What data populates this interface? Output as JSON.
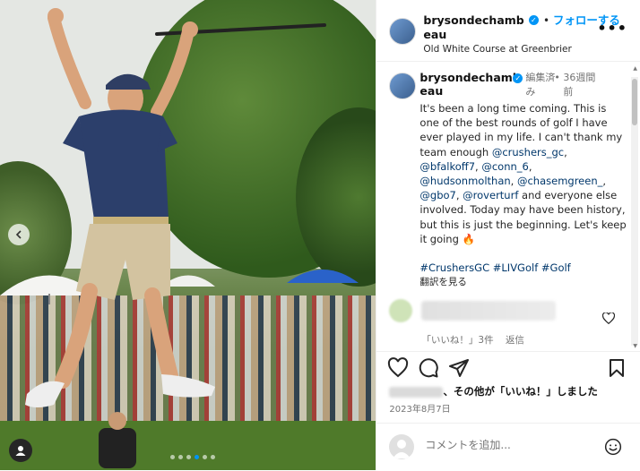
{
  "post": {
    "username": "brysondechambeau",
    "username_line1": "brysondechamb",
    "username_line2": "eau",
    "follow_label": "フォローする",
    "location": "Old White Course at Greenbrier",
    "more_label": "•••"
  },
  "caption": {
    "username_line1": "brysondechamb",
    "username_line2": "eau",
    "edited_line1": "編集済",
    "edited_line2": "み",
    "age_line1": "36週間",
    "age_line2": "前",
    "text_part1": "It's been a long time coming. This is one of the best rounds of golf I have ever played in my life. I can't thank my team enough ",
    "mention1": "@crushers_gc",
    "comma1": ", ",
    "mention2": "@bfalkoff7",
    "comma2": ", ",
    "mention3": "@conn_6",
    "comma3": ", ",
    "mention4": "@hudsonmolthan",
    "comma4": ", ",
    "mention5": "@chasemgreen_",
    "comma5": ", ",
    "mention6": "@gbo7",
    "comma6": ", ",
    "mention7": "@roverturf",
    "text_part2": " and everyone else involved. Today may have been history, but this is just the beginning. Let's keep it going 🔥",
    "hashtags": "#CrushersGC #LIVGolf #Golf",
    "translate_label": "翻訳を見る"
  },
  "comment": {
    "likes_label": "「いいね！」3件",
    "reply_label": "返信"
  },
  "footer": {
    "liked_by_suffix": "、その他が「いいね！」しました",
    "date": "2023年8月7日",
    "comment_placeholder": "コメントを追加..."
  },
  "colors": {
    "accent": "#0095f6",
    "mention": "#00376b"
  }
}
